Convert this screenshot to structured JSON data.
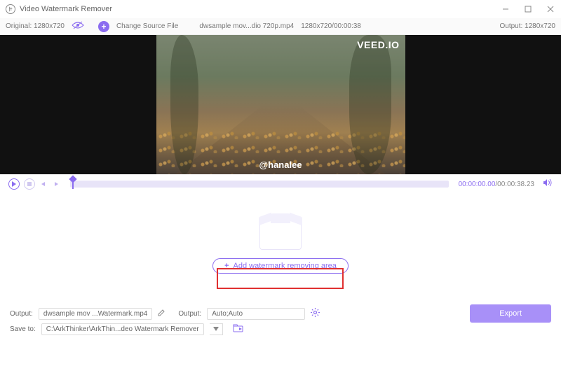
{
  "titlebar": {
    "title": "Video Watermark Remover"
  },
  "ribbon": {
    "original_label": "Original: 1280x720",
    "change_label": "Change Source File",
    "filename": "dwsample mov...dio 720p.mp4",
    "fileinfo": "1280x720/00:00:38",
    "output_label": "Output: 1280x720"
  },
  "video": {
    "watermark_brand": "VEED.IO",
    "credit": "@hanalee"
  },
  "player": {
    "current": "00:00:00.00",
    "duration": "/00:00:38.23"
  },
  "drop": {
    "add_label": "Add watermark removing area"
  },
  "footer": {
    "output_label": "Output:",
    "output_file": "dwsample mov ...Watermark.mp4",
    "output2_label": "Output:",
    "output2_value": "Auto;Auto",
    "saveto_label": "Save to:",
    "saveto_path": "C:\\ArkThinker\\ArkThin...deo Watermark Remover",
    "export_label": "Export"
  }
}
